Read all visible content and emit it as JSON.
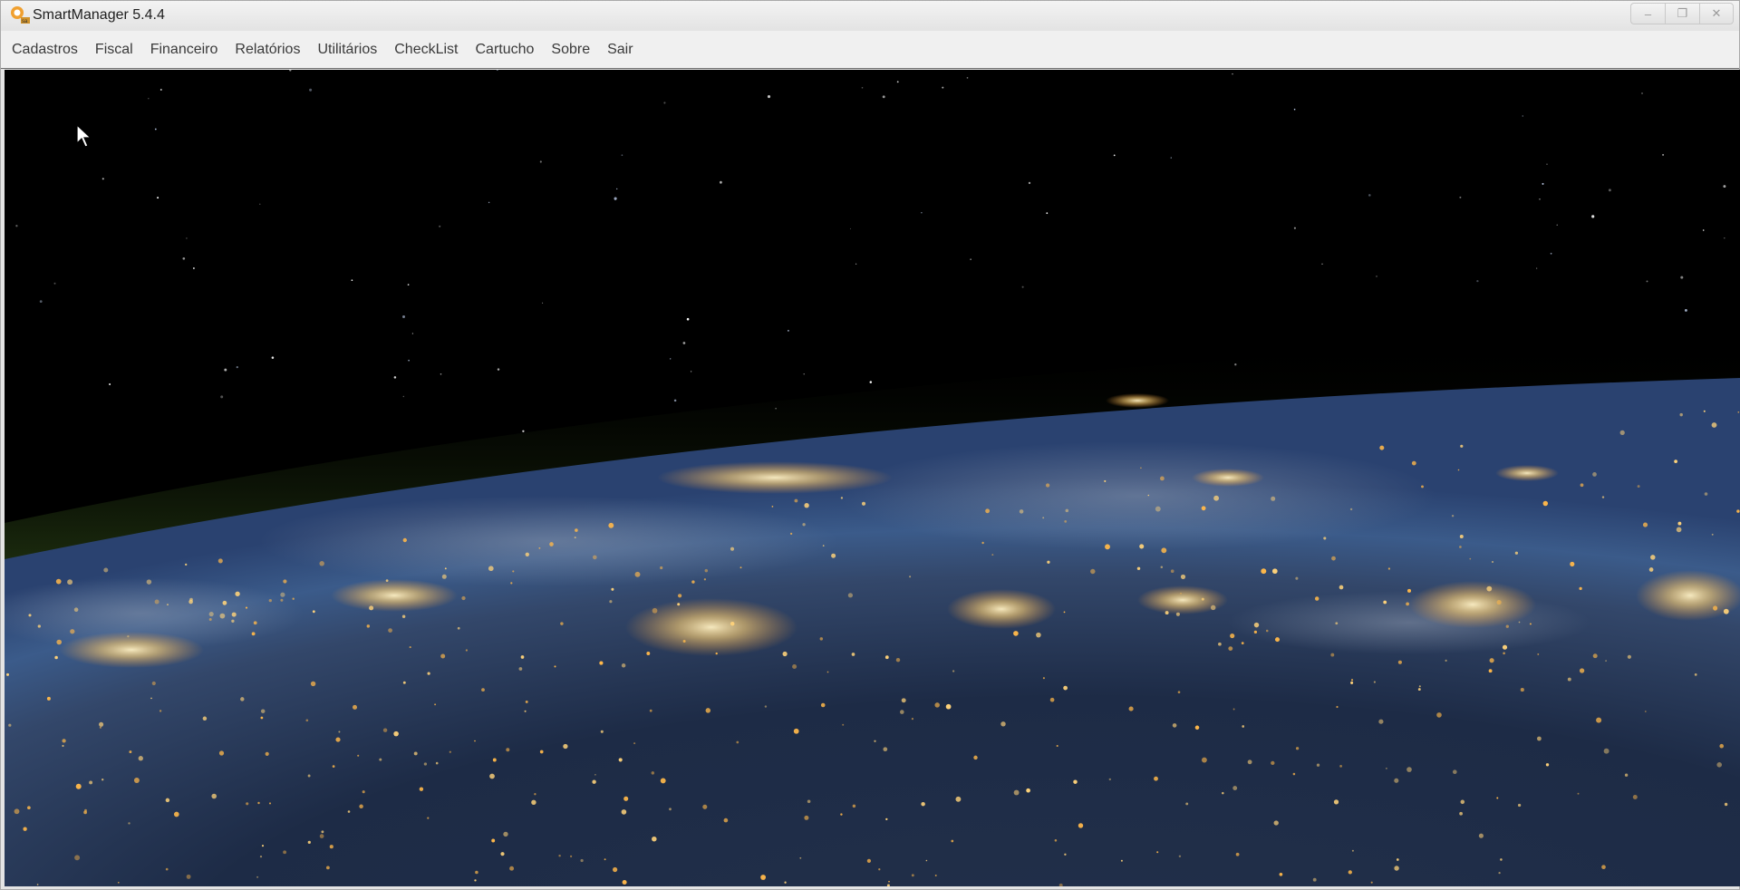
{
  "window": {
    "title": "SmartManager 5.4.4",
    "icon": "smartmanager-app-icon",
    "controls": {
      "minimize": "–",
      "maximize": "❐",
      "close": "✕"
    }
  },
  "menu": {
    "items": [
      "Cadastros",
      "Fiscal",
      "Financeiro",
      "Relatórios",
      "Utilitários",
      "CheckList",
      "Cartucho",
      "Sobre",
      "Sair"
    ]
  },
  "desktop": {
    "background": "earth-at-night-wallpaper",
    "colors": {
      "space": "#000000",
      "atmosphere": "#3c5a1e",
      "earth": "#1c2a44",
      "city_lights": "#ffd37a"
    }
  }
}
